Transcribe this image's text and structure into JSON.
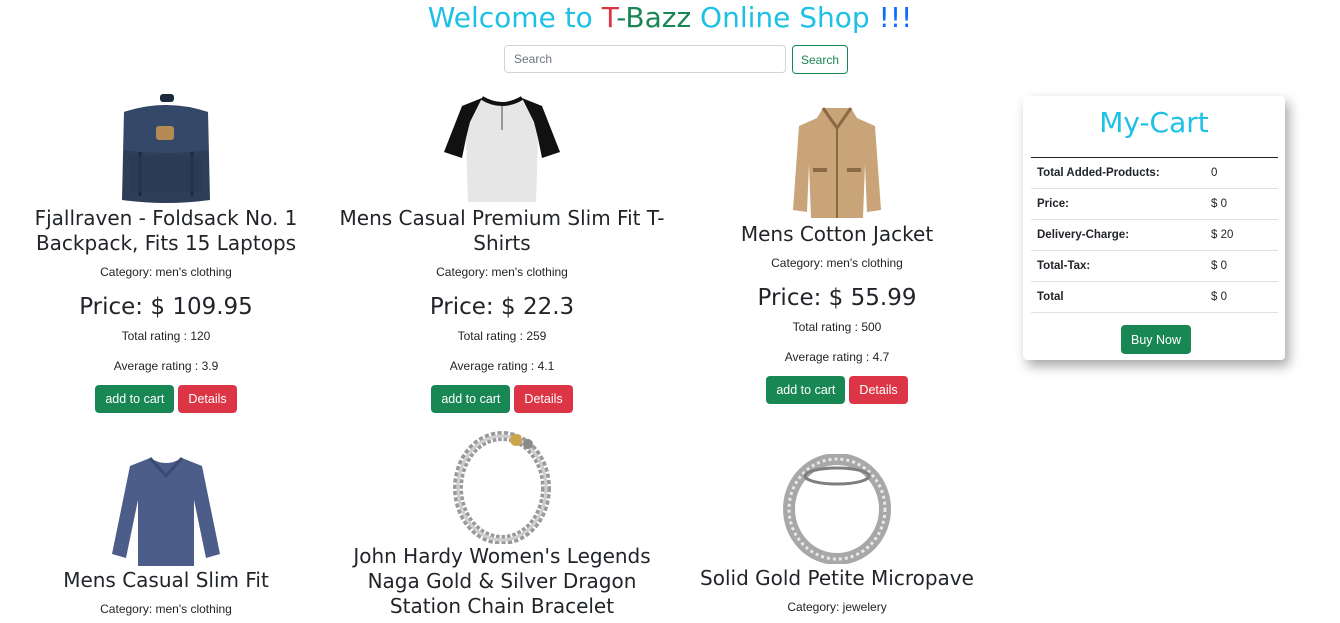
{
  "header": {
    "title_welcome": "Welcome to ",
    "title_t": "T",
    "title_dash": "-",
    "title_bazz": "Bazz",
    "title_rest": " Online Shop ",
    "title_bang": "!!!"
  },
  "search": {
    "placeholder": "Search",
    "value": "",
    "button_label": "Search"
  },
  "colors": {
    "accent": "#1ec0e6",
    "green": "#198754",
    "red": "#dc3545",
    "blue": "#0d6efd"
  },
  "products": [
    {
      "name": "Fjallraven - Foldsack No. 1 Backpack, Fits 15 Laptops",
      "category": "Category: men's clothing",
      "price": "Price: $ 109.95",
      "total_rating": "Total rating : 120",
      "average_rating": "Average rating : 3.9",
      "add_label": "add to cart",
      "details_label": "Details",
      "icon": "backpack-image"
    },
    {
      "name": "Mens Casual Premium Slim Fit T-Shirts",
      "category": "Category: men's clothing",
      "price": "Price: $ 22.3",
      "total_rating": "Total rating : 259",
      "average_rating": "Average rating : 4.1",
      "add_label": "add to cart",
      "details_label": "Details",
      "icon": "tshirt-image"
    },
    {
      "name": "Mens Cotton Jacket",
      "category": "Category: men's clothing",
      "price": "Price: $ 55.99",
      "total_rating": "Total rating : 500",
      "average_rating": "Average rating : 4.7",
      "add_label": "add to cart",
      "details_label": "Details",
      "icon": "jacket-image"
    },
    {
      "name": "Mens Casual Slim Fit",
      "category": "Category: men's clothing",
      "icon": "longsleeve-image"
    },
    {
      "name": "John Hardy Women's Legends Naga Gold & Silver Dragon Station Chain Bracelet",
      "icon": "bracelet-image"
    },
    {
      "name": "Solid Gold Petite Micropave",
      "category": "Category: jewelery",
      "icon": "ring-image"
    }
  ],
  "cart": {
    "title": "My-Cart",
    "rows": [
      {
        "label": "Total Added-Products:",
        "value": "0"
      },
      {
        "label": "Price:",
        "value": "$ 0"
      },
      {
        "label": "Delivery-Charge:",
        "value": "$ 20"
      },
      {
        "label": "Total-Tax:",
        "value": "$ 0"
      },
      {
        "label": "Total",
        "value": "$ 0"
      }
    ],
    "buy_label": "Buy Now"
  }
}
